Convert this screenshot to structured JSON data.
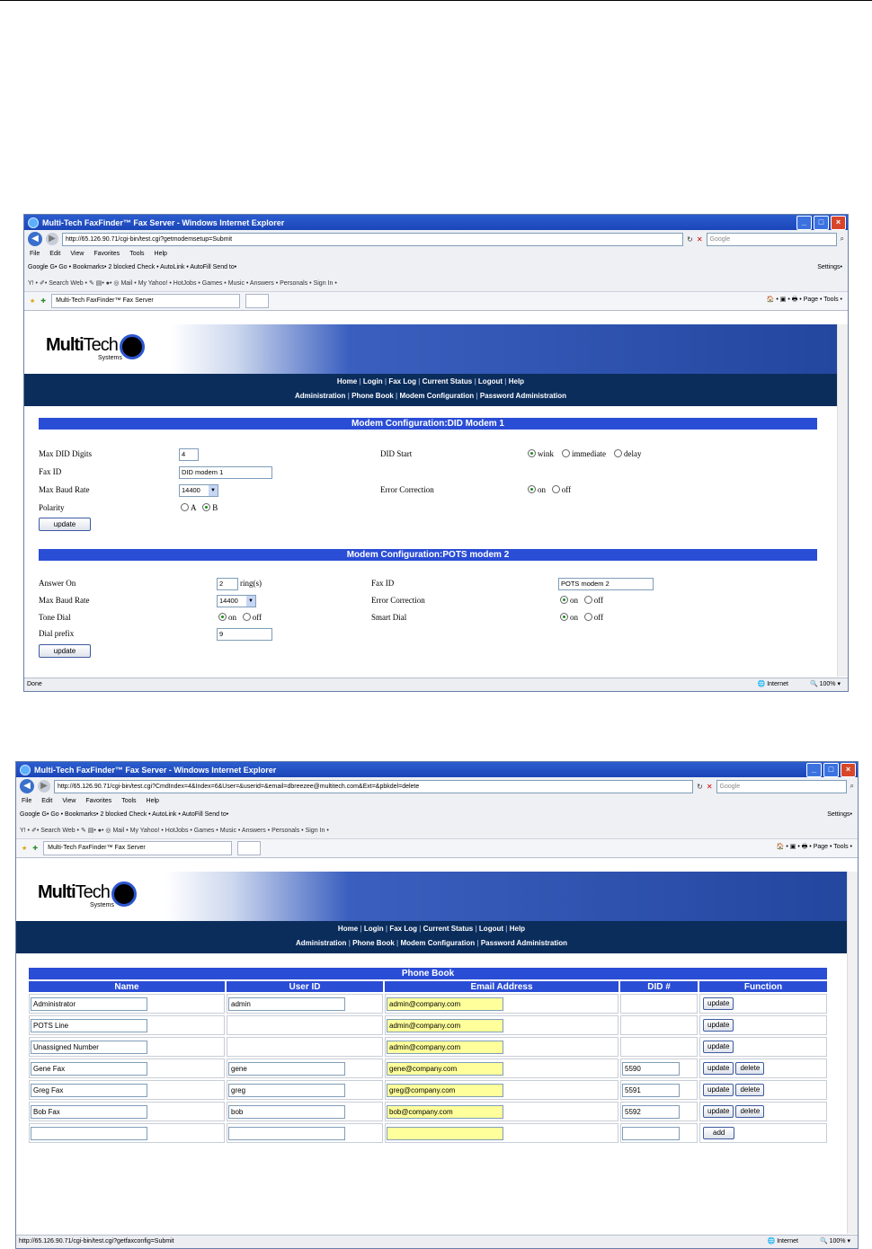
{
  "window1": {
    "title": "Multi-Tech FaxFinder™ Fax Server - Windows Internet Explorer",
    "url": "http://65.126.90.71/cgi-bin/test.cgi?getmodemsetup=Submit",
    "search_placeholder": "Google",
    "menu": [
      "File",
      "Edit",
      "View",
      "Favorites",
      "Tools",
      "Help"
    ],
    "google_bar": "Google  G•     Go • Bookmarks•  2 blocked  Check •  AutoLink •  AutoFill  Send to•",
    "google_settings": "Settings•",
    "yahoo_bar": "Y! • ✐•     Search Web •  ✎  ▤•  ●•  ◎  Mail •  My Yahoo! •  HotJobs •  Games •  Music •  Answers •  Personals •  Sign In •",
    "tab_label": "Multi-Tech FaxFinder™ Fax Server",
    "tab_tools": "🏠 • ▣ • 🖶 • Page • Tools •",
    "status_left": "Done",
    "status_zone": "Internet",
    "status_zoom": "100%",
    "nav_row1": [
      "Home",
      "Login",
      "Fax Log",
      "Current Status",
      "Logout",
      "Help"
    ],
    "nav_row2": [
      "Administration",
      "Phone Book",
      "Modem Configuration",
      "Password Administration"
    ],
    "section1": {
      "header": "Modem Configuration:DID Modem 1",
      "max_did_digits_label": "Max DID Digits",
      "max_did_digits_value": "4",
      "fax_id_label": "Fax ID",
      "fax_id_value": "DID modem 1",
      "max_baud_label": "Max Baud Rate",
      "max_baud_value": "14400",
      "polarity_label": "Polarity",
      "polarity_a": "A",
      "polarity_b": "B",
      "did_start_label": "DID Start",
      "did_start_wink": "wink",
      "did_start_immediate": "immediate",
      "did_start_delay": "delay",
      "error_corr_label": "Error Correction",
      "on": "on",
      "off": "off",
      "update": "update"
    },
    "section2": {
      "header": "Modem Configuration:POTS modem 2",
      "answer_on_label": "Answer On",
      "answer_on_value": "2",
      "rings": "ring(s)",
      "max_baud_label": "Max Baud Rate",
      "max_baud_value": "14400",
      "tone_dial_label": "Tone Dial",
      "dial_prefix_label": "Dial prefix",
      "dial_prefix_value": "9",
      "fax_id_label": "Fax ID",
      "fax_id_value": "POTS modem 2",
      "error_corr_label": "Error Correction",
      "smart_dial_label": "Smart Dial",
      "on": "on",
      "off": "off",
      "update": "update"
    }
  },
  "window2": {
    "title": "Multi-Tech FaxFinder™ Fax Server - Windows Internet Explorer",
    "url": "http://65.126.90.71/cgi-bin/test.cgi?CmdIndex=4&Index=6&User=&userid=&email=dbreezee@multitech.com&Ext=&pbkdel=delete",
    "search_placeholder": "Google",
    "tab_label": "Multi-Tech FaxFinder™ Fax Server",
    "status_left": "http://65.126.90.71/cgi-bin/test.cgi?getfaxconfig=Submit",
    "status_zone": "Internet",
    "status_zoom": "100%",
    "phonebook": {
      "title": "Phone Book",
      "columns": [
        "Name",
        "User ID",
        "Email Address",
        "DID #",
        "Function"
      ],
      "update": "update",
      "delete": "delete",
      "add": "add",
      "rows": [
        {
          "name": "Administrator",
          "userid": "admin",
          "email": "admin@company.com",
          "did": "",
          "has_userid": true,
          "has_did": false,
          "deletable": false
        },
        {
          "name": "POTS Line",
          "userid": "",
          "email": "admin@company.com",
          "did": "",
          "has_userid": false,
          "has_did": false,
          "deletable": false
        },
        {
          "name": "Unassigned Number",
          "userid": "",
          "email": "admin@company.com",
          "did": "",
          "has_userid": false,
          "has_did": false,
          "deletable": false
        },
        {
          "name": "Gene Fax",
          "userid": "gene",
          "email": "gene@company.com",
          "did": "5590",
          "has_userid": true,
          "has_did": true,
          "deletable": true
        },
        {
          "name": "Greg Fax",
          "userid": "greg",
          "email": "greg@company.com",
          "did": "5591",
          "has_userid": true,
          "has_did": true,
          "deletable": true
        },
        {
          "name": "Bob Fax",
          "userid": "bob",
          "email": "bob@company.com",
          "did": "5592",
          "has_userid": true,
          "has_did": true,
          "deletable": true
        }
      ]
    }
  }
}
